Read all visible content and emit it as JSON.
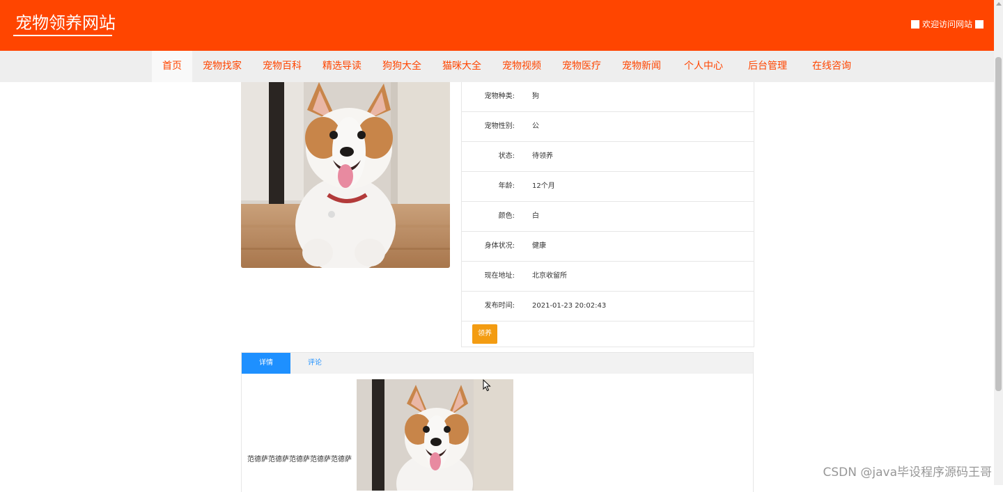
{
  "header": {
    "site_title": "宠物领养网站",
    "welcome": "欢迎访问网站"
  },
  "nav": {
    "items": [
      {
        "label": "首页"
      },
      {
        "label": "宠物找家"
      },
      {
        "label": "宠物百科"
      },
      {
        "label": "精选导读"
      },
      {
        "label": "狗狗大全"
      },
      {
        "label": "猫咪大全"
      },
      {
        "label": "宠物视频"
      },
      {
        "label": "宠物医疗"
      },
      {
        "label": "宠物新闻"
      },
      {
        "label": "个人中心"
      },
      {
        "label": "后台管理"
      },
      {
        "label": "在线咨询"
      }
    ]
  },
  "pet": {
    "fields": [
      {
        "label": "宠物种类:",
        "value": "狗"
      },
      {
        "label": "宠物性别:",
        "value": "公"
      },
      {
        "label": "状态:",
        "value": "待领养"
      },
      {
        "label": "年龄:",
        "value": "12个月"
      },
      {
        "label": "颜色:",
        "value": "白"
      },
      {
        "label": "身体状况:",
        "value": "健康"
      },
      {
        "label": "现在地址:",
        "value": "北京收留所"
      },
      {
        "label": "发布时间:",
        "value": "2021-01-23 20:02:43"
      }
    ],
    "adopt_label": "领养"
  },
  "tabs": {
    "items": [
      {
        "label": "详情"
      },
      {
        "label": "评论"
      }
    ],
    "detail_text": "范德萨范德萨范德萨范德萨范德萨"
  },
  "watermark": "CSDN @java毕设程序源码王哥",
  "colors": {
    "brand": "#ff4500",
    "tab_active": "#1e90ff",
    "button": "#f39c12"
  }
}
